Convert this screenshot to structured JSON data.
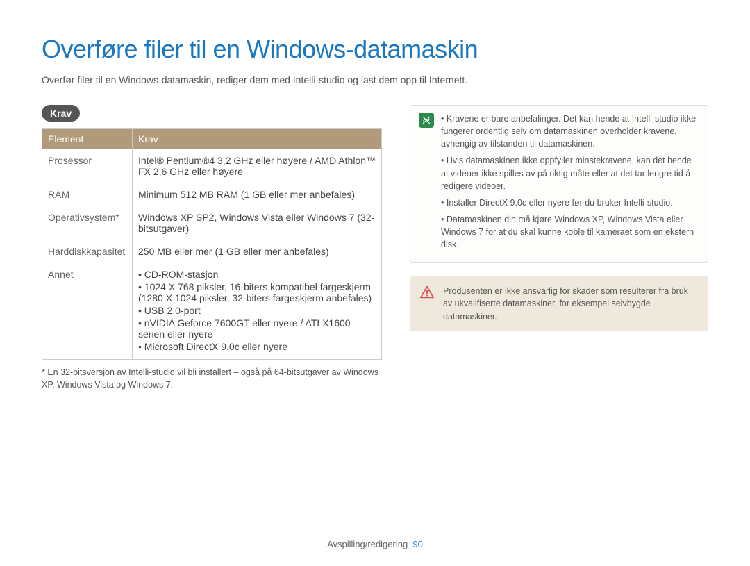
{
  "title": "Overføre filer til en Windows-datamaskin",
  "subtitle": "Overfør filer til en Windows-datamaskin, rediger dem med Intelli-studio og last dem opp til Internett.",
  "section_label": "Krav",
  "table": {
    "headers": [
      "Element",
      "Krav"
    ],
    "rows": [
      {
        "label": "Prosessor",
        "value": "Intel® Pentium®4 3,2 GHz eller høyere / AMD Athlon™ FX 2,6 GHz eller høyere"
      },
      {
        "label": "RAM",
        "value": "Minimum 512 MB RAM (1 GB eller mer anbefales)"
      },
      {
        "label": "Operativsystem*",
        "value": "Windows XP SP2, Windows Vista eller Windows 7 (32-bitsutgaver)"
      },
      {
        "label": "Harddiskkapasitet",
        "value": "250 MB eller mer (1 GB eller mer anbefales)"
      }
    ],
    "annet_label": "Annet",
    "annet_items": [
      "CD-ROM-stasjon",
      "1024 X 768 piksler, 16-biters kompatibel fargeskjerm (1280 X 1024 piksler, 32-biters fargeskjerm anbefales)",
      "USB 2.0-port",
      "nVIDIA Geforce 7600GT eller nyere / ATI X1600-serien eller nyere",
      "Microsoft DirectX 9.0c eller nyere"
    ]
  },
  "footnote": "* En 32-bitsversjon av Intelli-studio vil bli installert – også på 64-bitsutgaver av Windows XP, Windows Vista og Windows 7.",
  "notes": [
    "Kravene er bare anbefalinger. Det kan hende at Intelli-studio ikke fungerer ordentlig selv om datamaskinen overholder kravene, avhengig av tilstanden til datamaskinen.",
    "Hvis datamaskinen ikke oppfyller minstekravene, kan det hende at videoer ikke spilles av på riktig måte eller at det tar lengre tid å redigere videoer.",
    "Installer DirectX 9.0c eller nyere før du bruker Intelli-studio.",
    "Datamaskinen din må kjøre Windows XP, Windows Vista eller Windows 7 for at du skal kunne koble til kameraet som en ekstern disk."
  ],
  "warning": "Produsenten er ikke ansvarlig for skader som resulterer fra bruk av ukvalifiserte datamaskiner, for eksempel selvbygde datamaskiner.",
  "footer": {
    "section": "Avspilling/redigering",
    "page": "90"
  }
}
